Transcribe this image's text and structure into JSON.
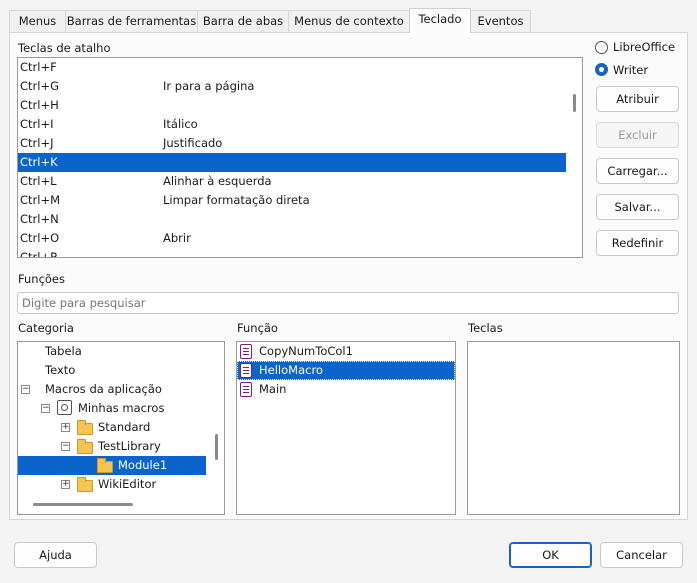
{
  "tabs": [
    "Menus",
    "Barras de ferramentas",
    "Barra de abas",
    "Menus de contexto",
    "Teclado",
    "Eventos"
  ],
  "active_tab": "Teclado",
  "shortcuts": {
    "label": "Teclas de atalho",
    "rows": [
      {
        "key": "Ctrl+F",
        "func": ""
      },
      {
        "key": "Ctrl+G",
        "func": "Ir para a página"
      },
      {
        "key": "Ctrl+H",
        "func": ""
      },
      {
        "key": "Ctrl+I",
        "func": "Itálico"
      },
      {
        "key": "Ctrl+J",
        "func": "Justificado"
      },
      {
        "key": "Ctrl+K",
        "func": ""
      },
      {
        "key": "Ctrl+L",
        "func": "Alinhar à esquerda"
      },
      {
        "key": "Ctrl+M",
        "func": "Limpar formatação direta"
      },
      {
        "key": "Ctrl+N",
        "func": ""
      },
      {
        "key": "Ctrl+O",
        "func": "Abrir"
      },
      {
        "key": "Ctrl+P",
        "func": ""
      }
    ],
    "selected": "Ctrl+K"
  },
  "scope": {
    "options": [
      "LibreOffice",
      "Writer"
    ],
    "selected": "Writer"
  },
  "side_buttons": {
    "assign": "Atribuir",
    "delete": "Excluir",
    "load": "Carregar...",
    "save": "Salvar...",
    "reset": "Redefinir"
  },
  "functions": {
    "label": "Funções",
    "search_placeholder": "Digite para pesquisar"
  },
  "category": {
    "label": "Categoria",
    "items": [
      "Tabela",
      "Texto",
      "Macros da aplicação",
      "Minhas macros",
      "Standard",
      "TestLibrary",
      "Module1",
      "WikiEditor"
    ],
    "selected": "Module1"
  },
  "function_list": {
    "label": "Função",
    "items": [
      "CopyNumToCol1",
      "HelloMacro",
      "Main"
    ],
    "selected": "HelloMacro"
  },
  "keys": {
    "label": "Teclas"
  },
  "footer": {
    "help": "Ajuda",
    "ok": "OK",
    "cancel": "Cancelar"
  },
  "colors": {
    "selection": "#0a64c9",
    "primary_border": "#1b62b9"
  }
}
